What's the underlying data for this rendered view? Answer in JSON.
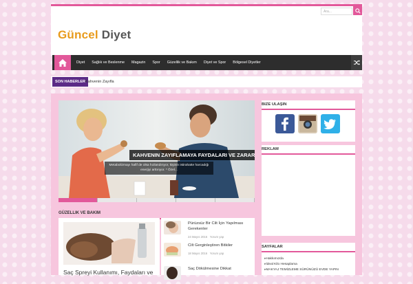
{
  "topbar": {
    "search_placeholder": "Ara...",
    "accent": "#e2589a"
  },
  "logo": {
    "part1": "Güncel",
    "part2": "Diyet"
  },
  "nav": {
    "home_icon": "home-icon",
    "items": [
      "Diyet",
      "Sağlık ve Beslenme",
      "Magazin",
      "Spor",
      "Güzellik ve Bakım",
      "Diyet ve Spor",
      "Bölgesel Diyetler"
    ],
    "shuffle_icon": "shuffle-icon"
  },
  "breaking": {
    "label": "Son Haberler",
    "text": "Kahvenin Zayıfla"
  },
  "slider": {
    "title": "Kahvenin Zayıflamaya Faydaları ve Zararları",
    "desc": "Metabolizmayı hafif de olsa hızlandırıyor, kişinin istirahatte harcadığı enerjiyi arttırıyor. * Özel..."
  },
  "section": {
    "title": "Güzellik ve Bakım"
  },
  "featured": {
    "title": "Saç Spreyi Kullanımı, Faydaları ve"
  },
  "list": [
    {
      "title": "Pürüzsüz Bir Cilt İçin Yapılması Gerekenler",
      "date": "24 Mayıs 2016",
      "comment": "Yorum yap"
    },
    {
      "title": "Cilt Gerginleştiren Bitkiler",
      "date": "18 Mayıs 2016",
      "comment": "Yorum yap"
    },
    {
      "title": "Saç Dökülmesine Dikkat",
      "date": "",
      "comment": ""
    }
  ],
  "sidebar": {
    "social_title": "Bize Ulaşın",
    "ads_title": "Reklam",
    "pages_title": "Sayfalar",
    "pages": [
      "Hakkımızda",
      "İdeal Kilo Hesaplama",
      "MAKYAJ TEMİZLEME SÜRÜNÜZÜ EVDE YAPIN"
    ]
  }
}
